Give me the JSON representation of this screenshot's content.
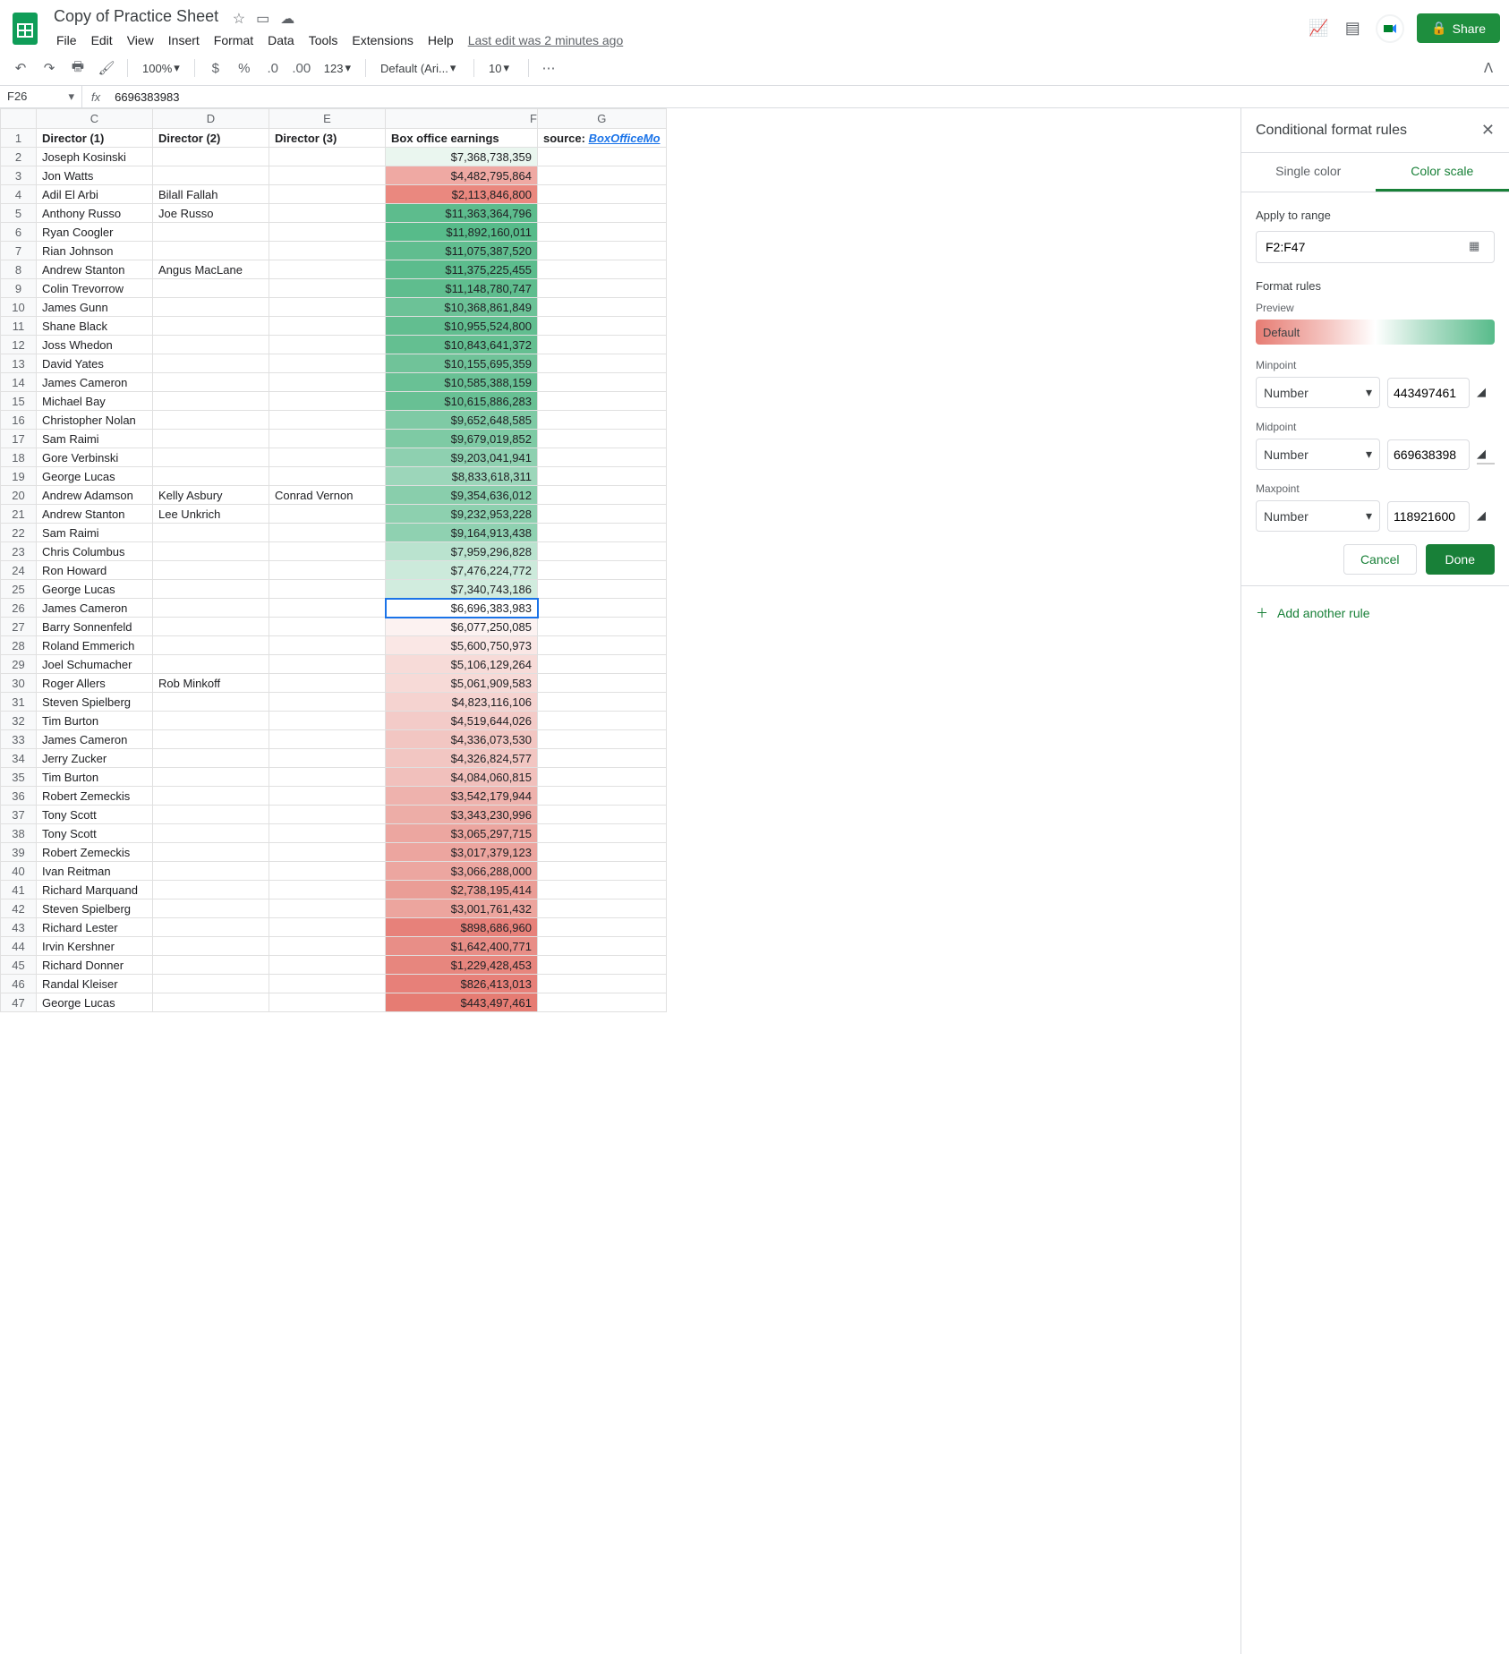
{
  "doc": {
    "title": "Copy of Practice Sheet",
    "last_edit": "Last edit was 2 minutes ago"
  },
  "menubar": [
    "File",
    "Edit",
    "View",
    "Insert",
    "Format",
    "Data",
    "Tools",
    "Extensions",
    "Help"
  ],
  "toolbar": {
    "zoom": "100%",
    "font": "Default (Ari...",
    "size": "10",
    "fmt": "123"
  },
  "share": "Share",
  "formula": {
    "cell": "F26",
    "value": "6696383983"
  },
  "columns": [
    "C",
    "D",
    "E",
    "F",
    "G"
  ],
  "headers": {
    "c": "Director (1)",
    "d": "Director (2)",
    "e": "Director (3)",
    "f": "Box office earnings",
    "g_src": "source:",
    "g_link": "BoxOfficeMo"
  },
  "rows": [
    {
      "n": 2,
      "c": "Joseph Kosinski",
      "d": "",
      "e": "",
      "f": "$7,368,738,359",
      "bg": "#eaf6ef"
    },
    {
      "n": 3,
      "c": "Jon Watts",
      "d": "",
      "e": "",
      "f": "$4,482,795,864",
      "bg": "#efa9a3"
    },
    {
      "n": 4,
      "c": "Adil El Arbi",
      "d": "Bilall Fallah",
      "e": "",
      "f": "$2,113,846,800",
      "bg": "#ea887f"
    },
    {
      "n": 5,
      "c": "Anthony Russo",
      "d": "Joe Russo",
      "e": "",
      "f": "$11,363,364,796",
      "bg": "#5dbc8d"
    },
    {
      "n": 6,
      "c": "Ryan Coogler",
      "d": "",
      "e": "",
      "f": "$11,892,160,011",
      "bg": "#57bb8a"
    },
    {
      "n": 7,
      "c": "Rian Johnson",
      "d": "",
      "e": "",
      "f": "$11,075,387,520",
      "bg": "#60bd8f"
    },
    {
      "n": 8,
      "c": "Andrew Stanton",
      "d": "Angus MacLane",
      "e": "",
      "f": "$11,375,225,455",
      "bg": "#5cbc8d"
    },
    {
      "n": 9,
      "c": "Colin Trevorrow",
      "d": "",
      "e": "",
      "f": "$11,148,780,747",
      "bg": "#5fbd8e"
    },
    {
      "n": 10,
      "c": "James Gunn",
      "d": "",
      "e": "",
      "f": "$10,368,861,849",
      "bg": "#6cc297"
    },
    {
      "n": 11,
      "c": "Shane Black",
      "d": "",
      "e": "",
      "f": "$10,955,524,800",
      "bg": "#62be90"
    },
    {
      "n": 12,
      "c": "Joss Whedon",
      "d": "",
      "e": "",
      "f": "$10,843,641,372",
      "bg": "#64bf91"
    },
    {
      "n": 13,
      "c": "David Yates",
      "d": "",
      "e": "",
      "f": "$10,155,695,359",
      "bg": "#70c399"
    },
    {
      "n": 14,
      "c": "James Cameron",
      "d": "",
      "e": "",
      "f": "$10,585,388,159",
      "bg": "#69c195"
    },
    {
      "n": 15,
      "c": "Michael Bay",
      "d": "",
      "e": "",
      "f": "$10,615,886,283",
      "bg": "#68c094"
    },
    {
      "n": 16,
      "c": "Christopher Nolan",
      "d": "",
      "e": "",
      "f": "$9,652,648,585",
      "bg": "#7fcaa5"
    },
    {
      "n": 17,
      "c": "Sam Raimi",
      "d": "",
      "e": "",
      "f": "$9,679,019,852",
      "bg": "#7ecaa4"
    },
    {
      "n": 18,
      "c": "Gore Verbinski",
      "d": "",
      "e": "",
      "f": "$9,203,041,941",
      "bg": "#8ed0b0"
    },
    {
      "n": 19,
      "c": "George Lucas",
      "d": "",
      "e": "",
      "f": "$8,833,618,311",
      "bg": "#9cd6ba"
    },
    {
      "n": 20,
      "c": "Andrew Adamson",
      "d": "Kelly Asbury",
      "e": "Conrad Vernon",
      "f": "$9,354,636,012",
      "bg": "#89ceac"
    },
    {
      "n": 21,
      "c": "Andrew Stanton",
      "d": "Lee Unkrich",
      "e": "",
      "f": "$9,232,953,228",
      "bg": "#8dd0af"
    },
    {
      "n": 22,
      "c": "Sam Raimi",
      "d": "",
      "e": "",
      "f": "$9,164,913,438",
      "bg": "#8fd1b1"
    },
    {
      "n": 23,
      "c": "Chris Columbus",
      "d": "",
      "e": "",
      "f": "$7,959,296,828",
      "bg": "#bae3cf"
    },
    {
      "n": 24,
      "c": "Ron Howard",
      "d": "",
      "e": "",
      "f": "$7,476,224,772",
      "bg": "#cceadb"
    },
    {
      "n": 25,
      "c": "George Lucas",
      "d": "",
      "e": "",
      "f": "$7,340,743,186",
      "bg": "#d1ecde"
    },
    {
      "n": 26,
      "c": "James Cameron",
      "d": "",
      "e": "",
      "f": "$6,696,383,983",
      "bg": "#ffffff",
      "sel": true
    },
    {
      "n": 27,
      "c": "Barry Sonnenfeld",
      "d": "",
      "e": "",
      "f": "$6,077,250,085",
      "bg": "#fcf2f1"
    },
    {
      "n": 28,
      "c": "Roland Emmerich",
      "d": "",
      "e": "",
      "f": "$5,600,750,973",
      "bg": "#fae7e5"
    },
    {
      "n": 29,
      "c": "Joel Schumacher",
      "d": "",
      "e": "",
      "f": "$5,106,129,264",
      "bg": "#f7dbd8"
    },
    {
      "n": 30,
      "c": "Roger Allers",
      "d": "Rob Minkoff",
      "e": "",
      "f": "$5,061,909,583",
      "bg": "#f7dad7"
    },
    {
      "n": 31,
      "c": "Steven Spielberg",
      "d": "",
      "e": "",
      "f": "$4,823,116,106",
      "bg": "#f5d3d0"
    },
    {
      "n": 32,
      "c": "Tim Burton",
      "d": "",
      "e": "",
      "f": "$4,519,644,026",
      "bg": "#f3cbc8"
    },
    {
      "n": 33,
      "c": "James Cameron",
      "d": "",
      "e": "",
      "f": "$4,336,073,530",
      "bg": "#f2c6c2"
    },
    {
      "n": 34,
      "c": "Jerry Zucker",
      "d": "",
      "e": "",
      "f": "$4,326,824,577",
      "bg": "#f2c6c2"
    },
    {
      "n": 35,
      "c": "Tim Burton",
      "d": "",
      "e": "",
      "f": "$4,084,060,815",
      "bg": "#f1c0bc"
    },
    {
      "n": 36,
      "c": "Robert Zemeckis",
      "d": "",
      "e": "",
      "f": "$3,542,179,944",
      "bg": "#eeb2ad"
    },
    {
      "n": 37,
      "c": "Tony Scott",
      "d": "",
      "e": "",
      "f": "$3,343,230,996",
      "bg": "#edada7"
    },
    {
      "n": 38,
      "c": "Tony Scott",
      "d": "",
      "e": "",
      "f": "$3,065,297,715",
      "bg": "#eca6a0"
    },
    {
      "n": 39,
      "c": "Robert Zemeckis",
      "d": "",
      "e": "",
      "f": "$3,017,379,123",
      "bg": "#eca59f"
    },
    {
      "n": 40,
      "c": "Ivan Reitman",
      "d": "",
      "e": "",
      "f": "$3,066,288,000",
      "bg": "#eca6a0"
    },
    {
      "n": 41,
      "c": "Richard Marquand",
      "d": "",
      "e": "",
      "f": "$2,738,195,414",
      "bg": "#ea9d96"
    },
    {
      "n": 42,
      "c": "Steven Spielberg",
      "d": "",
      "e": "",
      "f": "$3,001,761,432",
      "bg": "#eca59e"
    },
    {
      "n": 43,
      "c": "Richard Lester",
      "d": "",
      "e": "",
      "f": "$898,686,960",
      "bg": "#e7817a"
    },
    {
      "n": 44,
      "c": "Irvin Kershner",
      "d": "",
      "e": "",
      "f": "$1,642,400,771",
      "bg": "#e88e87"
    },
    {
      "n": 45,
      "c": "Richard Donner",
      "d": "",
      "e": "",
      "f": "$1,229,428,453",
      "bg": "#e7867e"
    },
    {
      "n": 46,
      "c": "Randal Kleiser",
      "d": "",
      "e": "",
      "f": "$826,413,013",
      "bg": "#e78079"
    },
    {
      "n": 47,
      "c": "George Lucas",
      "d": "",
      "e": "",
      "f": "$443,497,461",
      "bg": "#e67c73"
    }
  ],
  "panel": {
    "title": "Conditional format rules",
    "tab_single": "Single color",
    "tab_scale": "Color scale",
    "apply_label": "Apply to range",
    "range": "F2:F47",
    "rules_label": "Format rules",
    "preview_label": "Preview",
    "preview_text": "Default",
    "min_label": "Minpoint",
    "mid_label": "Midpoint",
    "max_label": "Maxpoint",
    "type": "Number",
    "min_val": "443497461",
    "mid_val": "669638398",
    "max_val": "118921600",
    "cancel": "Cancel",
    "done": "Done",
    "add_rule": "Add another rule"
  }
}
